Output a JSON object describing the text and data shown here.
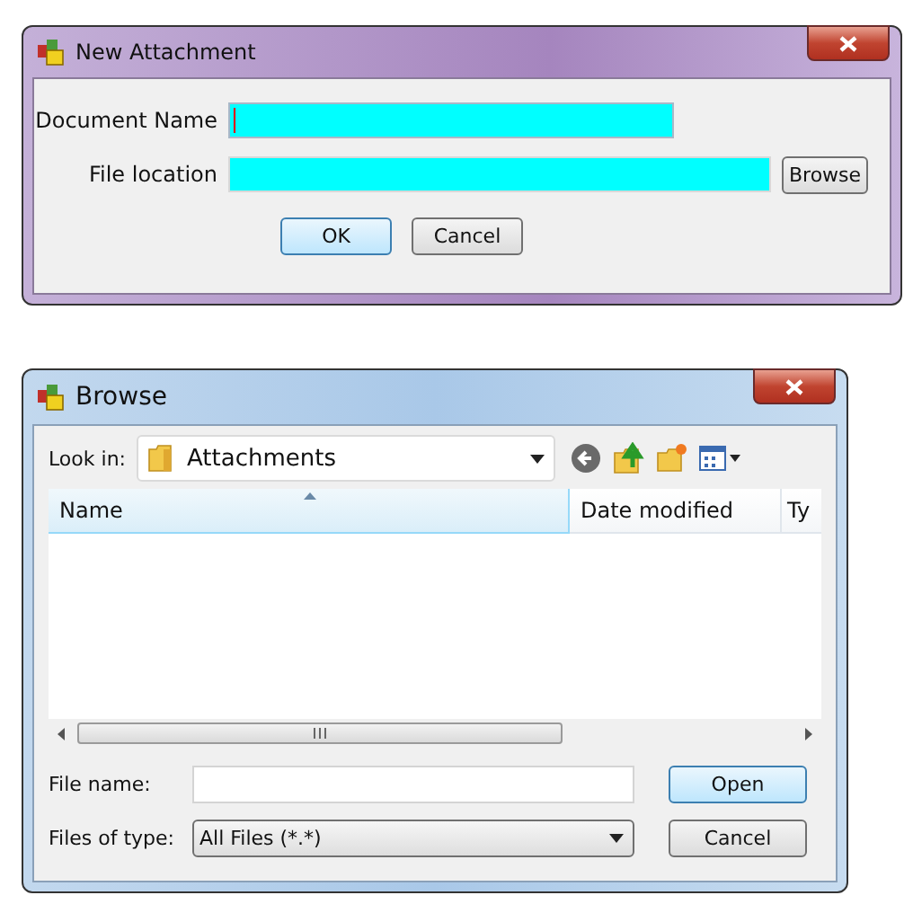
{
  "attachment_dialog": {
    "title": "New Attachment",
    "fields": [
      {
        "label": "Document Name",
        "focused": true
      },
      {
        "label": "File location",
        "focused": false,
        "button": "Browse"
      }
    ],
    "buttons": [
      {
        "label": "OK",
        "default": true
      },
      {
        "label": "Cancel",
        "default": false
      }
    ]
  },
  "browse_dialog": {
    "title": "Browse",
    "look_in": {
      "label": "Look in:",
      "value": "Attachments"
    },
    "columns": [
      {
        "label": "Name",
        "sorted": true
      },
      {
        "label": "Date modified",
        "sorted": false
      },
      {
        "label": "Ty",
        "sorted": false
      }
    ],
    "file_name": {
      "label": "File name:"
    },
    "file_type": {
      "label": "Files of type:",
      "value": "All Files (*.*)"
    },
    "buttons": [
      {
        "label": "Open",
        "default": true
      },
      {
        "label": "Cancel",
        "default": false
      }
    ]
  }
}
